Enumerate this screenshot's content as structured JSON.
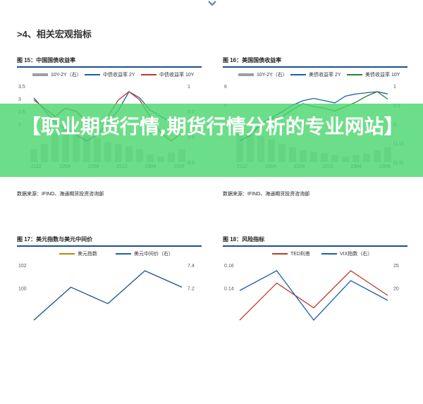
{
  "section": {
    "title": ">4、相关宏观指标"
  },
  "banner": {
    "text": "【职业期货行情,期货行情分析的专业网站】"
  },
  "figures": [
    {
      "id": "fig15",
      "title": "图 15：中国国债收益率",
      "legend": [
        "10Y-2Y（右）",
        "中债收益率 2Y",
        "中债收益率 10Y"
      ],
      "source": "数据来源：IFIND、海通期货投资咨询部"
    },
    {
      "id": "fig16",
      "title": "图 16：美国国债收益率",
      "legend": [
        "10Y-2Y（右）",
        "美债收益率 2Y",
        "美债收益率 10Y"
      ],
      "source": "数据来源：IFIND、海通期货投资咨询部"
    },
    {
      "id": "fig17",
      "title": "图 17：美元指数与美元中间价",
      "legend": [
        "美元指数",
        "美元中间价（右）"
      ]
    },
    {
      "id": "fig18",
      "title": "图 18：风险指标",
      "legend": [
        "TED利差",
        "VIX指数（右）"
      ]
    }
  ],
  "chart_data": [
    {
      "type": "line",
      "title": "图 15：中国国债收益率",
      "x_ticks": [
        "2112",
        "2204",
        "2208",
        "2212",
        "2304",
        "2308"
      ],
      "y_left_ticks": [
        3.5,
        3.0,
        2.5,
        2.0
      ],
      "y_right_ticks": [
        1.0,
        0.7,
        0.5,
        0.3
      ],
      "ylim_left": [
        1.5,
        3.5
      ],
      "series": [
        {
          "name": "10Y-2Y（右）",
          "kind": "bar",
          "color": "#9e9e9e",
          "values": [
            0.55,
            0.6,
            0.7,
            0.75,
            0.72,
            0.68,
            0.66,
            0.62,
            0.6,
            0.58,
            0.55,
            0.5,
            0.48,
            0.52,
            0.55
          ]
        },
        {
          "name": "中债收益率 2Y",
          "color": "#1f5fa8",
          "values": [
            2.4,
            2.3,
            2.2,
            2.15,
            2.1,
            2.05,
            2.1,
            2.2,
            2.3,
            2.45,
            2.4,
            2.3,
            2.25,
            2.2,
            2.25
          ]
        },
        {
          "name": "中债收益率 10Y",
          "color": "#c0392b",
          "values": [
            2.85,
            2.8,
            2.75,
            2.8,
            2.78,
            2.72,
            2.7,
            2.75,
            2.85,
            2.9,
            2.85,
            2.75,
            2.65,
            2.6,
            2.65
          ]
        }
      ]
    },
    {
      "type": "line",
      "title": "图 16：美国国债收益率",
      "x_ticks": [
        "2112",
        "2204",
        "2208",
        "2212",
        "2304",
        "2308"
      ],
      "y_left_ticks": [
        6.0,
        5.0,
        4.0
      ],
      "y_right_ticks": [
        1.0,
        0.5,
        0.0,
        "(1.0)",
        "(1.5)"
      ],
      "ylim_left": [
        0,
        6
      ],
      "series": [
        {
          "name": "10Y-2Y（右）",
          "kind": "bar",
          "color": "#9e9e9e",
          "values": [
            0.8,
            0.6,
            0.3,
            0.1,
            -0.2,
            -0.4,
            -0.6,
            -0.7,
            -0.8,
            -0.9,
            -1.0,
            -0.9,
            -0.8,
            -0.6,
            -0.4
          ]
        },
        {
          "name": "美债收益率 2Y",
          "color": "#1f5fa8",
          "values": [
            0.7,
            1.2,
            2.2,
            2.8,
            3.3,
            3.9,
            4.3,
            4.5,
            4.3,
            4.1,
            4.7,
            4.9,
            5.0,
            5.1,
            4.9
          ]
        },
        {
          "name": "美债收益率 10Y",
          "color": "#2e7d32",
          "values": [
            1.5,
            1.9,
            2.7,
            3.0,
            3.1,
            3.6,
            4.0,
            3.8,
            3.7,
            3.5,
            3.8,
            4.1,
            4.5,
            4.8,
            4.3
          ]
        }
      ]
    },
    {
      "type": "line",
      "title": "图 17：美元指数与美元中间价",
      "y_left_ticks": [
        102,
        100
      ],
      "y_right_ticks": [
        7.4,
        7.2
      ],
      "series": [
        {
          "name": "美元指数",
          "color": "#b8860b",
          "values": [
            101,
            103,
            102,
            104,
            103
          ]
        },
        {
          "name": "美元中间价（右）",
          "color": "#1f5fa8",
          "values": [
            7.1,
            7.2,
            7.15,
            7.25,
            7.2
          ]
        }
      ]
    },
    {
      "type": "line",
      "title": "图 18：风险指标",
      "y_left_ticks": [
        0.16,
        0.14
      ],
      "y_right_ticks": [
        25,
        20
      ],
      "series": [
        {
          "name": "TED利差",
          "color": "#c0392b",
          "values": [
            0.12,
            0.15,
            0.13,
            0.16,
            0.14
          ]
        },
        {
          "name": "VIX指数（右）",
          "color": "#1f5fa8",
          "values": [
            22,
            24,
            19,
            23,
            21
          ]
        }
      ]
    }
  ],
  "colors": {
    "banner": "#4cd66e",
    "title_rule": "#1e4f8f"
  }
}
